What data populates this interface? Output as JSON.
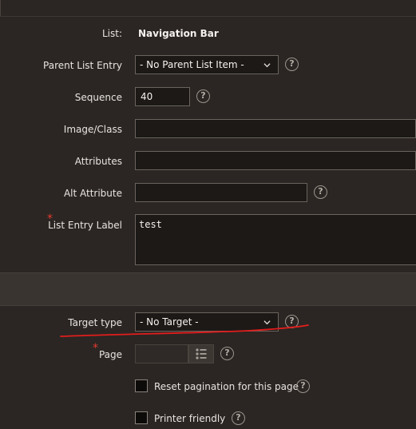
{
  "form": {
    "list": {
      "label": "List:",
      "value": "Navigation Bar"
    },
    "parent_list_entry": {
      "label": "Parent List Entry",
      "value": "- No Parent List Item -"
    },
    "sequence": {
      "label": "Sequence",
      "value": "40"
    },
    "image_class": {
      "label": "Image/Class",
      "value": ""
    },
    "attributes": {
      "label": "Attributes",
      "value": ""
    },
    "alt_attribute": {
      "label": "Alt Attribute",
      "value": ""
    },
    "list_entry_label": {
      "label": "List Entry Label",
      "value": "test",
      "required_mark": "*"
    },
    "target_type": {
      "label": "Target type",
      "value": "- No Target -"
    },
    "page": {
      "label": "Page",
      "value": "",
      "required_mark": "*"
    },
    "reset_pagination": {
      "label": "Reset pagination for this page",
      "checked": false
    },
    "printer_friendly": {
      "label": "Printer friendly",
      "checked": false
    }
  },
  "help_glyph": "?",
  "colors": {
    "background": "#2b2623",
    "field": "#1c1917",
    "required": "#e33a2f",
    "annotation": "#e11d1d"
  }
}
